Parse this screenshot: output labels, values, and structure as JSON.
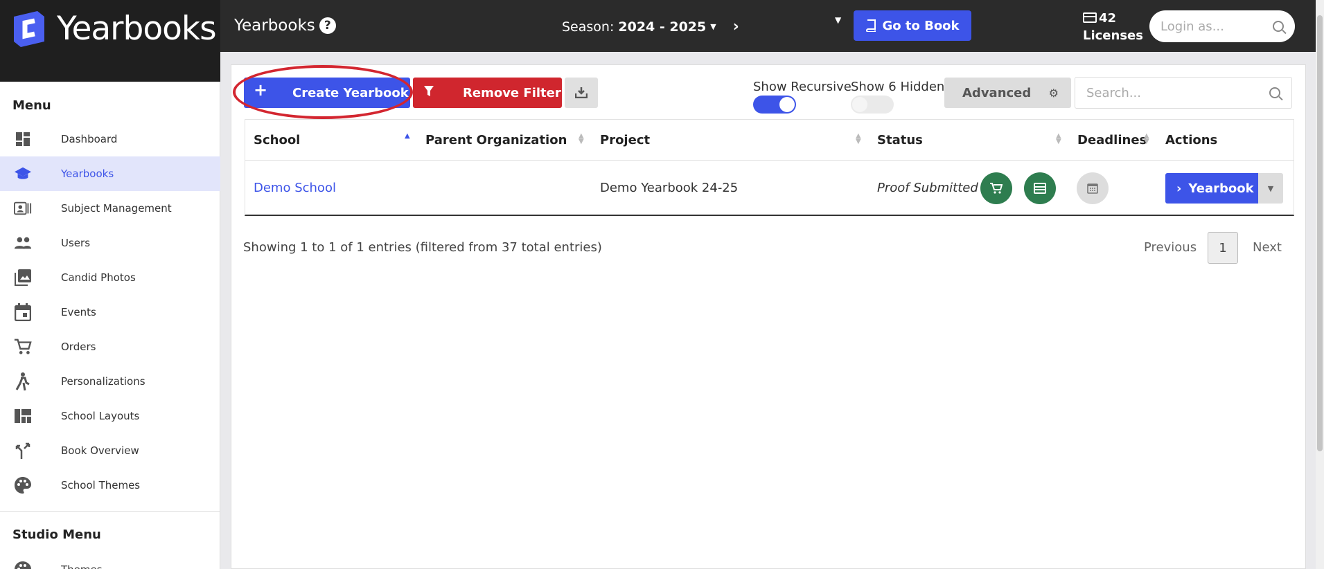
{
  "app": {
    "name": "Yearbooks"
  },
  "header": {
    "page_title": "Yearbooks",
    "season_label": "Season:",
    "season_value": "2024 - 2025",
    "goto_label": "Go to Book",
    "licenses_count": "42",
    "licenses_label": "Licenses",
    "login_placeholder": "Login as..."
  },
  "sidebar": {
    "menu_title": "Menu",
    "items": [
      {
        "label": "Dashboard",
        "icon": "dashboard-icon"
      },
      {
        "label": "Yearbooks",
        "icon": "graduation-cap-icon",
        "active": true
      },
      {
        "label": "Subject Management",
        "icon": "id-card-icon"
      },
      {
        "label": "Users",
        "icon": "users-icon"
      },
      {
        "label": "Candid Photos",
        "icon": "photos-icon"
      },
      {
        "label": "Events",
        "icon": "calendar-icon"
      },
      {
        "label": "Orders",
        "icon": "cart-icon"
      },
      {
        "label": "Personalizations",
        "icon": "person-icon"
      },
      {
        "label": "School Layouts",
        "icon": "layout-icon"
      },
      {
        "label": "Book Overview",
        "icon": "branch-icon"
      },
      {
        "label": "School Themes",
        "icon": "palette-icon"
      }
    ],
    "studio_title": "Studio Menu",
    "studio_items": [
      {
        "label": "Themes",
        "icon": "palette-icon"
      }
    ]
  },
  "toolbar": {
    "create_label": "Create Yearbook",
    "filter_label": "Remove Filter",
    "show_recursive_label": "Show Recursive",
    "show_hidden_label": "Show 6 Hidden",
    "advanced_label": "Advanced",
    "search_placeholder": "Search..."
  },
  "table": {
    "columns": [
      "School",
      "Parent Organization",
      "Project",
      "Status",
      "Deadlines",
      "Actions"
    ],
    "rows": [
      {
        "school": "Demo School",
        "parent": "",
        "project": "Demo Yearbook 24-25",
        "status": "Proof Submitted",
        "action": "Yearbook"
      }
    ]
  },
  "footer": {
    "info": "Showing 1 to 1 of 1 entries (filtered from 37 total entries)",
    "previous": "Previous",
    "page": "1",
    "next": "Next"
  },
  "colors": {
    "accent": "#3d54e8",
    "danger": "#d0262e",
    "success": "#2e7d4f",
    "topbar": "#2b2b2b"
  }
}
